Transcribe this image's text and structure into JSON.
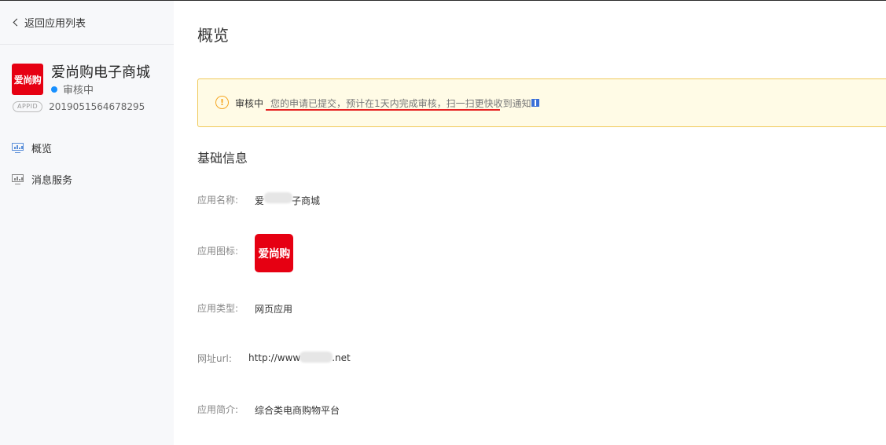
{
  "sidebar": {
    "back_label": "返回应用列表",
    "app": {
      "logo_text": "爱尚购",
      "name": "爱尚购电子商城",
      "status": "审核中",
      "appid_tag": "APPID",
      "appid": "2019051564678295"
    },
    "nav": [
      {
        "label": "概览",
        "icon": "chart-icon"
      },
      {
        "label": "消息服务",
        "icon": "chart-icon"
      }
    ]
  },
  "main": {
    "title": "概览",
    "notice": {
      "title": "审核中",
      "text": "您的申请已提交，预计在1天内完成审核，扫一扫更快收到通知",
      "icon": "warning-icon"
    },
    "section_title": "基础信息",
    "info": {
      "name_label": "应用名称:",
      "name_value_pre": "爱",
      "name_value_post": "子商城",
      "icon_label": "应用图标:",
      "icon_text": "爱尚购",
      "type_label": "应用类型:",
      "type_value": "网页应用",
      "url_label": "网址url:",
      "url_pre": "http://www",
      "url_post": ".net",
      "desc_label": "应用简介:",
      "desc_value": "综合类电商购物平台"
    }
  },
  "colors": {
    "brand_red": "#e60012",
    "status_blue": "#1890ff",
    "warning": "#f5a623",
    "highlight_red": "#e52222"
  }
}
